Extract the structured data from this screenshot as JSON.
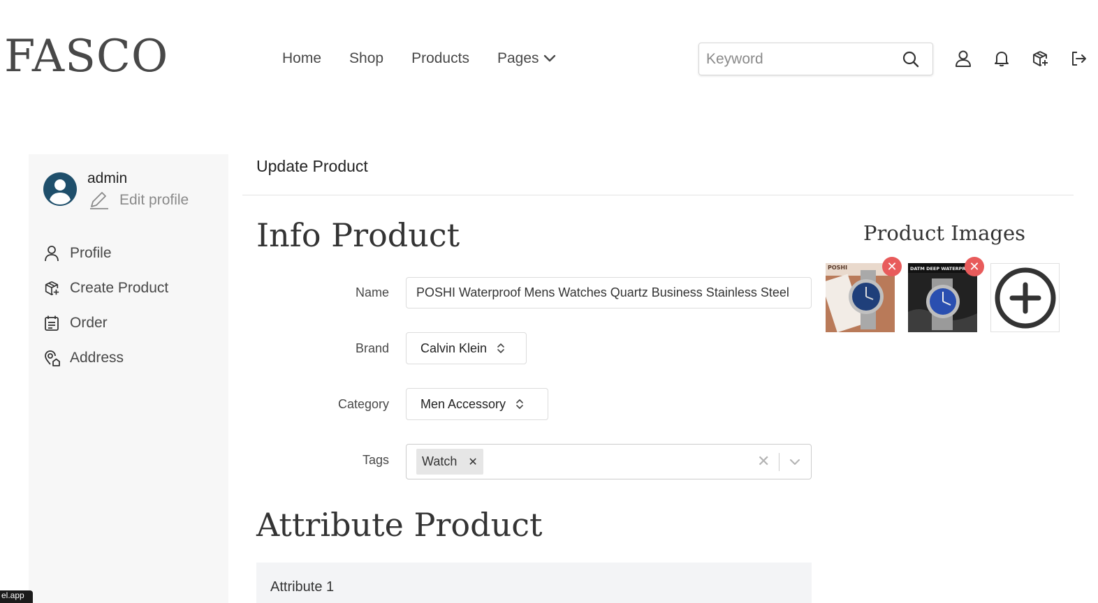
{
  "header": {
    "logo": "FASCO",
    "nav": [
      {
        "label": "Home"
      },
      {
        "label": "Shop"
      },
      {
        "label": "Products"
      },
      {
        "label": "Pages"
      }
    ],
    "search": {
      "placeholder": "Keyword",
      "value": ""
    },
    "icons": [
      "search-icon",
      "user-icon",
      "bell-icon",
      "package-add-icon",
      "logout-icon"
    ]
  },
  "sidebar": {
    "username": "admin",
    "edit_profile": "Edit profile",
    "items": [
      {
        "label": "Profile",
        "icon": "user-icon"
      },
      {
        "label": "Create Product",
        "icon": "package-add-icon"
      },
      {
        "label": "Order",
        "icon": "calendar-list-icon"
      },
      {
        "label": "Address",
        "icon": "location-home-icon"
      }
    ]
  },
  "main": {
    "page_title": "Update Product",
    "info_heading": "Info Product",
    "attribute_heading": "Attribute Product",
    "images_heading": "Product Images",
    "form": {
      "name_label": "Name",
      "name_value": "POSHI Waterproof Mens Watches Quartz Business Stainless Steel",
      "brand_label": "Brand",
      "brand_value": "Calvin Klein",
      "category_label": "Category",
      "category_value": "Men Accessory",
      "tags_label": "Tags",
      "tags": [
        "Watch"
      ]
    },
    "attributes": [
      {
        "label": "Attribute 1"
      }
    ],
    "images": [
      {
        "caption": "POSHI"
      },
      {
        "caption": "DATM DEEP WATERPROOF"
      }
    ]
  },
  "footer_badge": "el.app",
  "colors": {
    "text": "#484848",
    "sidebar_bg": "#f7f7f7",
    "avatar": "#1f4f6b",
    "remove": "#e85b5b"
  }
}
